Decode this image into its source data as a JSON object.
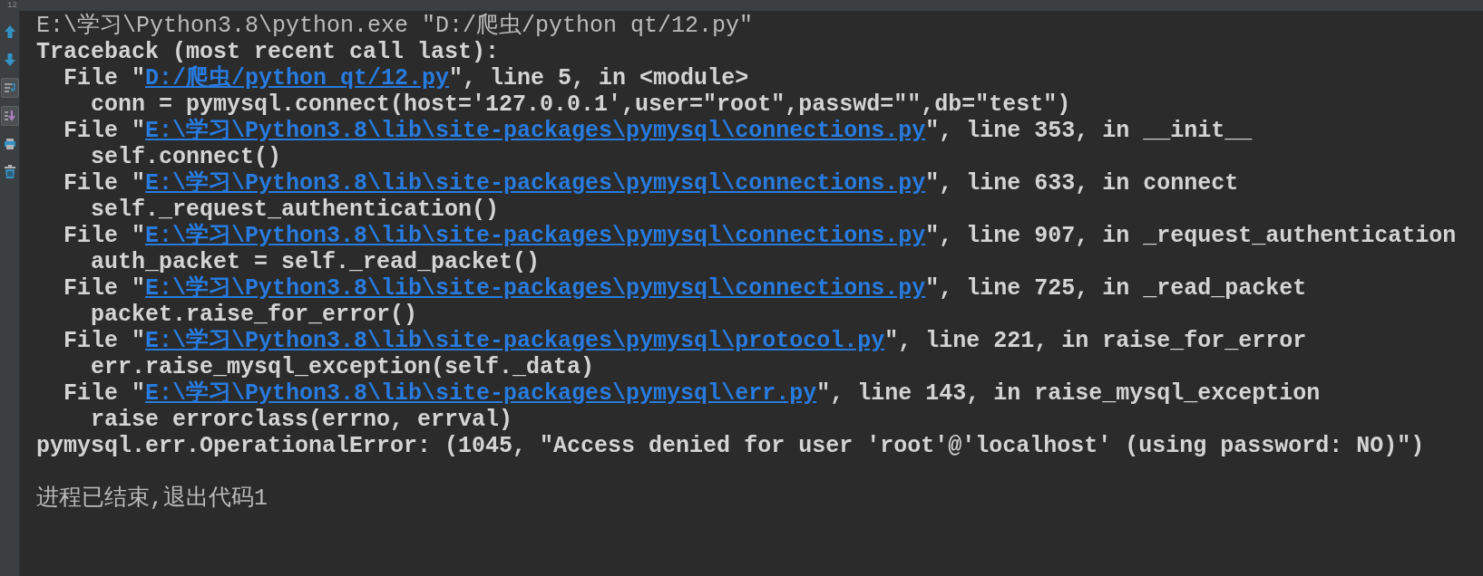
{
  "tab": {
    "label": "12"
  },
  "toolbar": [
    {
      "kind": "up",
      "toggled": false
    },
    {
      "kind": "down",
      "toggled": false
    },
    {
      "kind": "wrap",
      "toggled": true
    },
    {
      "kind": "scroll",
      "toggled": true
    },
    {
      "kind": "print",
      "toggled": false
    },
    {
      "kind": "trash",
      "toggled": false
    }
  ],
  "console_lines": [
    {
      "kind": "command",
      "text": "E:\\学习\\Python3.8\\python.exe \"D:/爬虫/python qt/12.py\""
    },
    {
      "kind": "error",
      "text": "Traceback (most recent call last):"
    },
    {
      "kind": "file",
      "prefix": "  File \"",
      "link": "D:/爬虫/python qt/12.py",
      "suffix": "\", line 5, in <module>"
    },
    {
      "kind": "error",
      "text": "    conn = pymysql.connect(host='127.0.0.1',user=\"root\",passwd=\"\",db=\"test\")"
    },
    {
      "kind": "file",
      "prefix": "  File \"",
      "link": "E:\\学习\\Python3.8\\lib\\site-packages\\pymysql\\connections.py",
      "suffix": "\", line 353, in __init__"
    },
    {
      "kind": "error",
      "text": "    self.connect()"
    },
    {
      "kind": "file",
      "prefix": "  File \"",
      "link": "E:\\学习\\Python3.8\\lib\\site-packages\\pymysql\\connections.py",
      "suffix": "\", line 633, in connect"
    },
    {
      "kind": "error",
      "text": "    self._request_authentication()"
    },
    {
      "kind": "file",
      "prefix": "  File \"",
      "link": "E:\\学习\\Python3.8\\lib\\site-packages\\pymysql\\connections.py",
      "suffix": "\", line 907, in _request_authentication"
    },
    {
      "kind": "error",
      "text": "    auth_packet = self._read_packet()"
    },
    {
      "kind": "file",
      "prefix": "  File \"",
      "link": "E:\\学习\\Python3.8\\lib\\site-packages\\pymysql\\connections.py",
      "suffix": "\", line 725, in _read_packet"
    },
    {
      "kind": "error",
      "text": "    packet.raise_for_error()"
    },
    {
      "kind": "file",
      "prefix": "  File \"",
      "link": "E:\\学习\\Python3.8\\lib\\site-packages\\pymysql\\protocol.py",
      "suffix": "\", line 221, in raise_for_error"
    },
    {
      "kind": "error",
      "text": "    err.raise_mysql_exception(self._data)"
    },
    {
      "kind": "file",
      "prefix": "  File \"",
      "link": "E:\\学习\\Python3.8\\lib\\site-packages\\pymysql\\err.py",
      "suffix": "\", line 143, in raise_mysql_exception"
    },
    {
      "kind": "error",
      "text": "    raise errorclass(errno, errval)"
    },
    {
      "kind": "error",
      "text": "pymysql.err.OperationalError: (1045, \"Access denied for user 'root'@'localhost' (using password: NO)\")"
    },
    {
      "kind": "exit",
      "text": "进程已结束,退出代码1"
    }
  ]
}
